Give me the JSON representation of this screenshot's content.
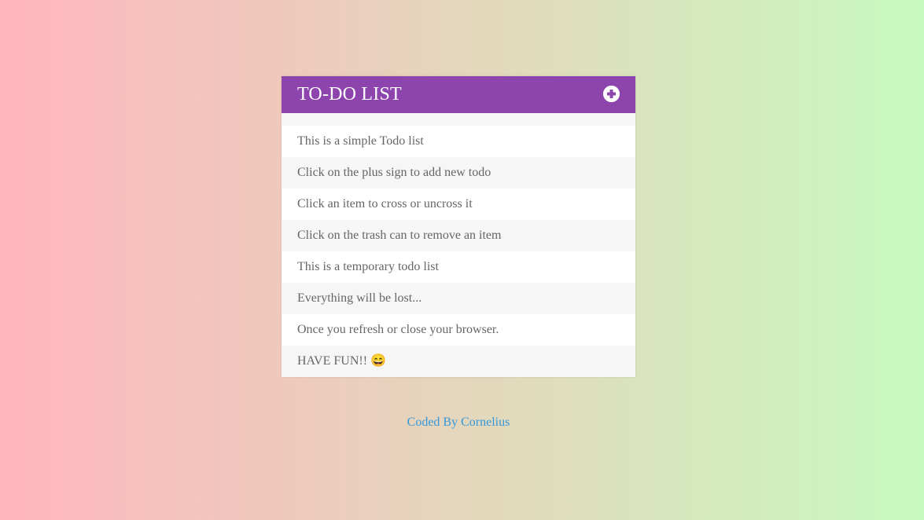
{
  "header": {
    "title": "TO-DO LIST",
    "add_icon": "plus-circle-icon"
  },
  "todos": [
    "This is a simple Todo list",
    "Click on the plus sign to add new todo",
    "Click an item to cross or uncross it",
    "Click on the trash can to remove an item",
    "This is a temporary todo list",
    "Everything will be lost...",
    "Once you refresh or close your browser.",
    "HAVE FUN!! 😄"
  ],
  "footer": {
    "credit": "Coded By Cornelius"
  },
  "colors": {
    "header_bg": "#8e44ad",
    "link": "#3498db",
    "text": "#666666",
    "gradient_start": "#ffb6bd",
    "gradient_end": "#c8f9c0"
  }
}
